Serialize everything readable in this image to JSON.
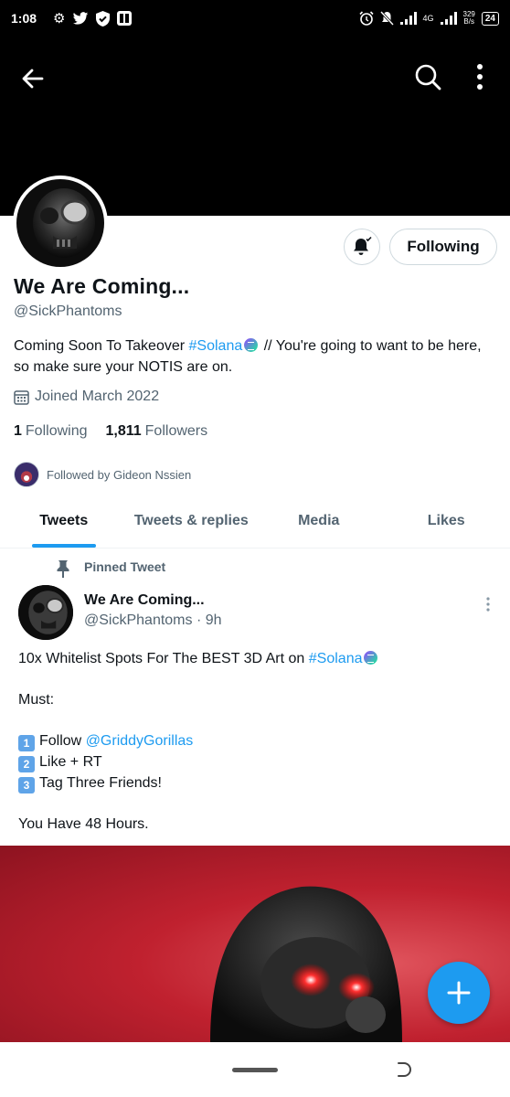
{
  "status_bar": {
    "time": "1:08",
    "network": "4G",
    "speed_value": "329",
    "speed_unit": "B/s",
    "battery": "24"
  },
  "profile": {
    "display_name": "We Are Coming...",
    "handle": "@SickPhantoms",
    "bio_before": "Coming Soon To Takeover ",
    "bio_hashtag": "#Solana",
    "bio_after": "  // You're going to want to be here, so make sure your NOTIS are on.",
    "joined": "Joined March 2022",
    "following_count": "1",
    "following_label": "Following",
    "followers_count": "1,811",
    "followers_label": "Followers",
    "followed_by": "Followed by Gideon Nssien",
    "follow_button_label": "Following"
  },
  "tabs": [
    {
      "label": "Tweets",
      "active": true
    },
    {
      "label": "Tweets & replies",
      "active": false
    },
    {
      "label": "Media",
      "active": false
    },
    {
      "label": "Likes",
      "active": false
    }
  ],
  "pinned_tweet": {
    "pinned_label": "Pinned Tweet",
    "author_name": "We Are Coming...",
    "author_handle": "@SickPhantoms",
    "time_ago": "9h",
    "line1_before": "10x Whitelist Spots For The BEST 3D Art on ",
    "line1_hashtag": "#Solana",
    "line2": "Must:",
    "step1_key": "1",
    "step1_before": "Follow ",
    "step1_mention": "@GriddyGorillas",
    "step2_key": "2",
    "step2_text": "Like + RT",
    "step3_key": "3",
    "step3_text": "Tag Three Friends!",
    "closing": "You Have 48 Hours."
  },
  "colors": {
    "accent": "#1d9bf0",
    "text_primary": "#0f1419",
    "text_secondary": "#536471",
    "banner": "#000000",
    "image_red": "#c0212f"
  },
  "icons": {
    "back": "arrow-left-icon",
    "search": "search-icon",
    "more": "more-vertical-icon",
    "bell": "bell-check-icon",
    "calendar": "calendar-icon",
    "pin": "pin-icon",
    "compose": "plus-icon"
  }
}
